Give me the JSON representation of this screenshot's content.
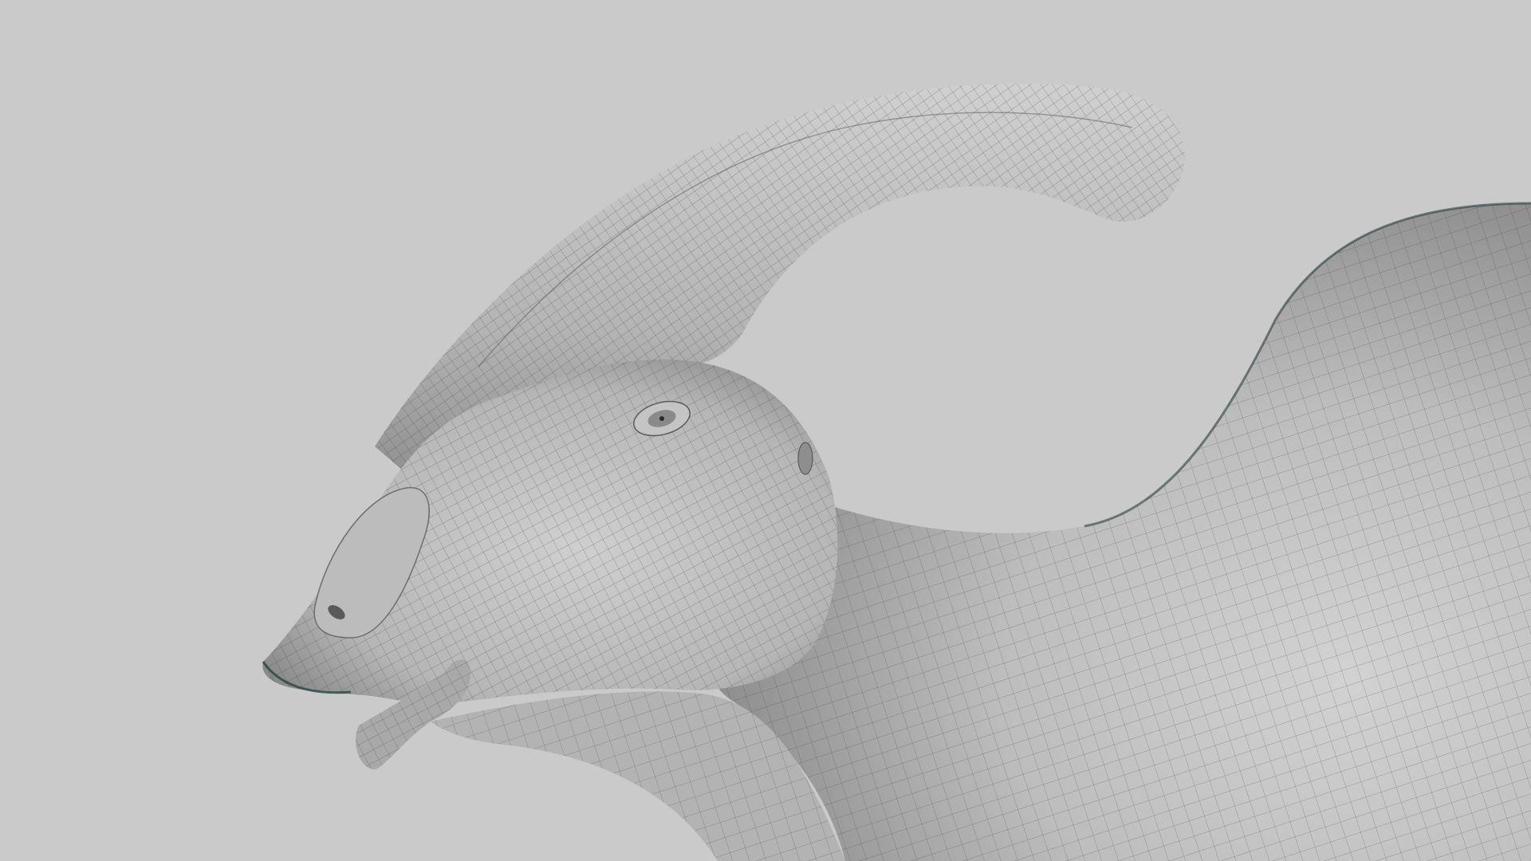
{
  "scene": {
    "subject": "wireframe-mesh-sculpt",
    "background_color": "#cacaca",
    "mesh_base_color": "#b9b9b9",
    "mesh_highlight_color": "#d6d6d6",
    "mesh_shadow_color": "#7e7e7e",
    "wire_color": "#3c3c3c",
    "rim_color": "#1e3a3a"
  }
}
